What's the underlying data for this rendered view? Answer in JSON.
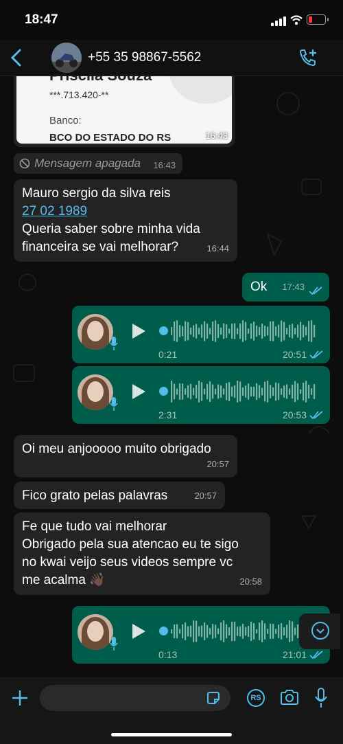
{
  "status": {
    "time": "18:47"
  },
  "header": {
    "contact": "+55 35 98867-5562"
  },
  "receipt": {
    "name_partial": "Priscila Souza",
    "doc": "***.713.420-**",
    "bank_label": "Banco:",
    "bank": "BCO DO ESTADO DO RS",
    "time": "16:43"
  },
  "deleted": {
    "text": "Mensagem apagada",
    "time": "16:43"
  },
  "messages": [
    {
      "line1": "Mauro sergio da silva reis",
      "link": "27 02 1989",
      "line3": "Queria saber sobre minha vida",
      "line4": "financeira se vai melhorar?",
      "time": "16:44"
    },
    {
      "text": "Ok",
      "time": "17:43"
    },
    {
      "text": "Oi meu anjooooo muito obrigado",
      "time": "20:57"
    },
    {
      "text": "Fico grato pelas palavras",
      "time": "20:57"
    },
    {
      "line1": "Fe que tudo vai melhorar",
      "line2": "Obrigado pela sua atencao eu te sigo",
      "line3": "no kwai veijo seus videos sempre vc",
      "line4": "me acalma 👋🏿",
      "time": "20:58"
    }
  ],
  "audios": [
    {
      "duration": "0:21",
      "time": "20:51"
    },
    {
      "duration": "2:31",
      "time": "20:53"
    },
    {
      "duration": "0:13",
      "time": "21:01"
    }
  ],
  "input": {
    "rs_badge": "RS"
  },
  "colors": {
    "accent": "#53bdeb",
    "outgoing": "#005c4b",
    "incoming": "#232323"
  }
}
